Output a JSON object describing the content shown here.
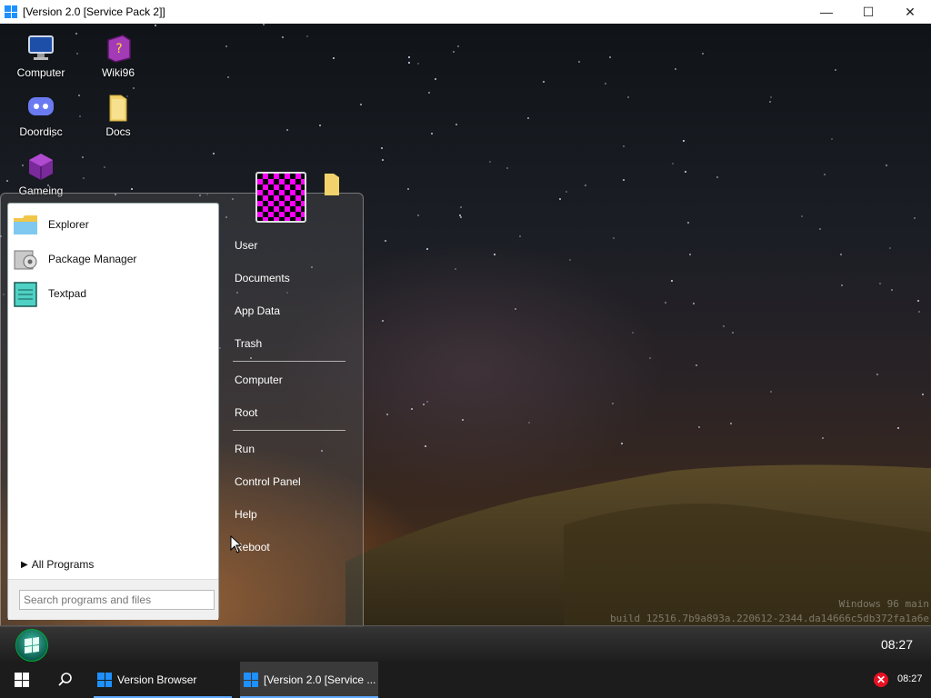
{
  "window": {
    "title": "[Version 2.0 [Service Pack 2]]",
    "controls": {
      "minimize": "—",
      "maximize": "☐",
      "close": "✕"
    }
  },
  "desktop": {
    "icons": [
      {
        "label": "Computer",
        "icon": "computer-icon"
      },
      {
        "label": "Wiki96",
        "icon": "help-book-icon"
      },
      {
        "label": "Doordisc",
        "icon": "chat-bubble-icon"
      },
      {
        "label": "Docs",
        "icon": "folder-icon"
      },
      {
        "label": "Gameing",
        "icon": "cube-icon"
      }
    ],
    "watermark_line1": "Windows 96 main",
    "watermark_line2": "build 12516.7b9a893a.220612-2344.da14666c5db372fa1a6e"
  },
  "start_menu": {
    "pinned": [
      {
        "label": "Explorer",
        "icon": "explorer-folder-icon"
      },
      {
        "label": "Package Manager",
        "icon": "package-manager-icon"
      },
      {
        "label": "Textpad",
        "icon": "textpad-icon"
      }
    ],
    "all_programs": "All Programs",
    "search_placeholder": "Search programs and files",
    "right_items": {
      "user": "User",
      "documents": "Documents",
      "app_data": "App Data",
      "trash": "Trash",
      "computer": "Computer",
      "root": "Root",
      "run": "Run",
      "control_panel": "Control Panel",
      "help": "Help",
      "reboot": "Reboot"
    }
  },
  "inner_taskbar": {
    "clock": "08:27"
  },
  "host_taskbar": {
    "tasks": [
      {
        "label": "Version Browser"
      },
      {
        "label": "[Version 2.0 [Service ..."
      }
    ],
    "clock": "08:27",
    "tray_error": "✕"
  },
  "colors": {
    "accent": "#1e90ff",
    "orb": "#3fbfa3",
    "avatar_magenta": "#ff00ff"
  }
}
